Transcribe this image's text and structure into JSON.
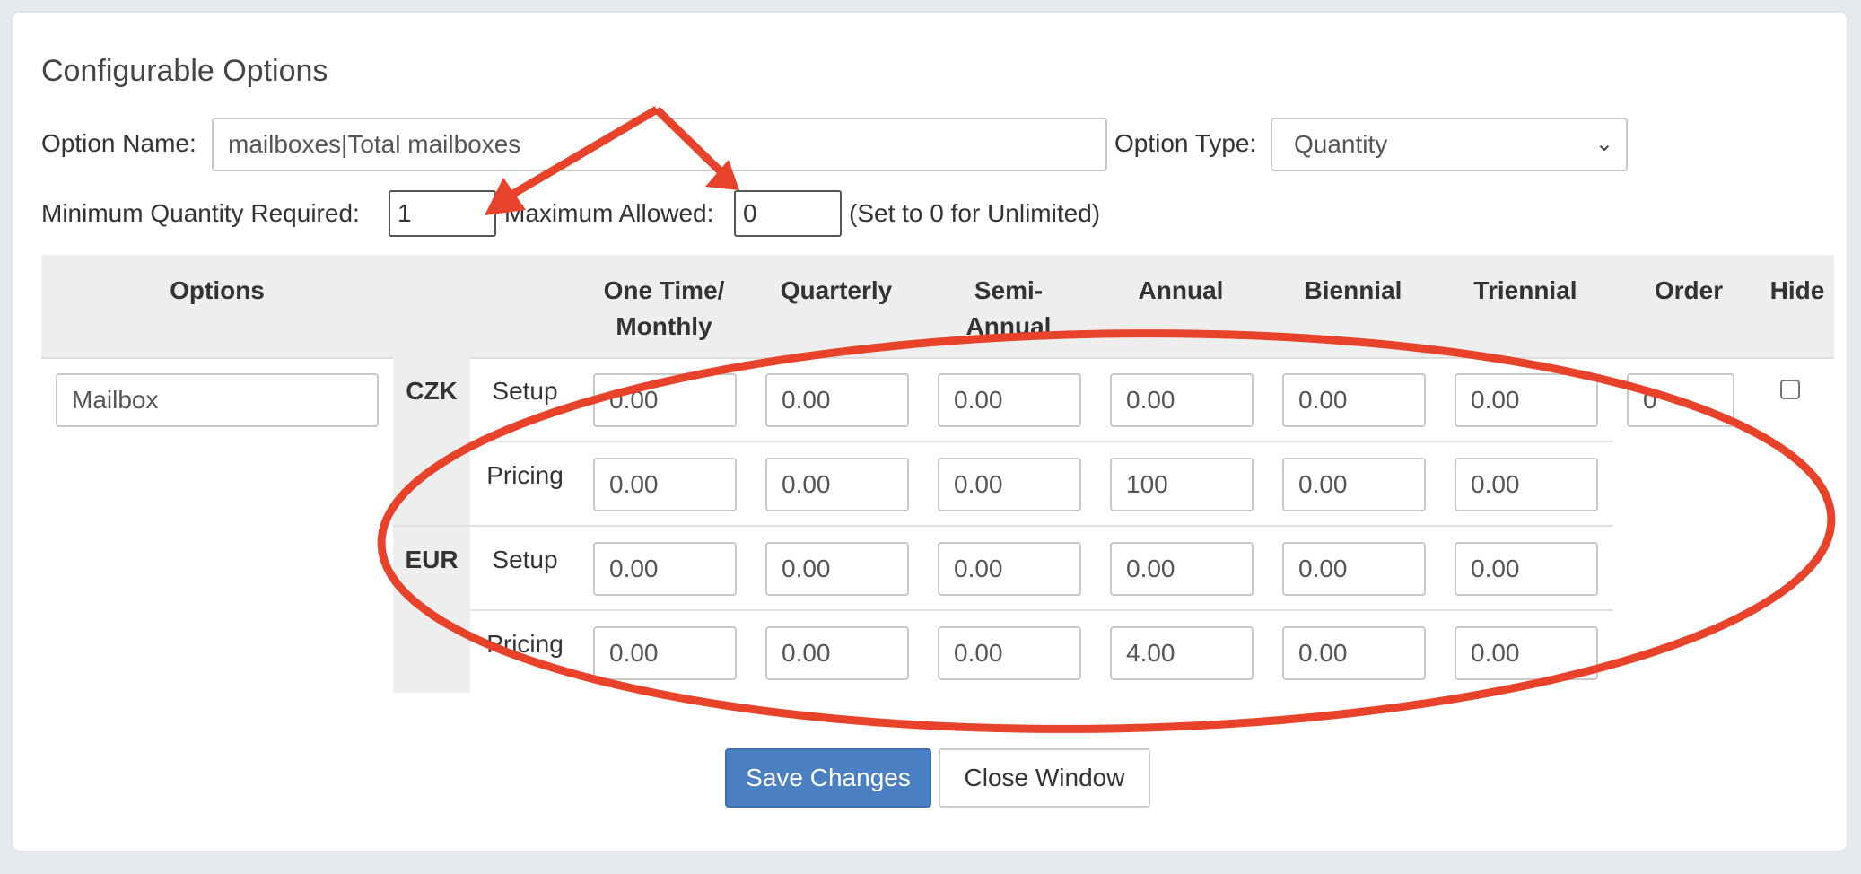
{
  "title": "Configurable Options",
  "option_name": {
    "label": "Option Name:",
    "value": "mailboxes|Total mailboxes"
  },
  "option_type": {
    "label": "Option Type:",
    "value": "Quantity"
  },
  "min_qty": {
    "label": "Minimum Quantity Required:",
    "value": "1"
  },
  "max_allowed": {
    "label": "Maximum Allowed:",
    "value": "0"
  },
  "unlimited_hint": "(Set to 0 for Unlimited)",
  "headers": {
    "options": "Options",
    "monthly_1": "One Time/",
    "monthly_2": "Monthly",
    "quarterly": "Quarterly",
    "semi_1": "Semi-",
    "semi_2": "Annual",
    "annual": "Annual",
    "biennial": "Biennial",
    "triennial": "Triennial",
    "order": "Order",
    "hide": "Hide"
  },
  "option_row": {
    "name": "Mailbox",
    "order": "0",
    "hidden": false
  },
  "row_labels": {
    "setup": "Setup",
    "pricing": "Pricing"
  },
  "currencies": [
    {
      "code": "CZK",
      "setup": [
        "0.00",
        "0.00",
        "0.00",
        "0.00",
        "0.00",
        "0.00"
      ],
      "pricing": [
        "0.00",
        "0.00",
        "0.00",
        "100",
        "0.00",
        "0.00"
      ]
    },
    {
      "code": "EUR",
      "setup": [
        "0.00",
        "0.00",
        "0.00",
        "0.00",
        "0.00",
        "0.00"
      ],
      "pricing": [
        "0.00",
        "0.00",
        "0.00",
        "4.00",
        "0.00",
        "0.00"
      ]
    }
  ],
  "buttons": {
    "save": "Save Changes",
    "close": "Close Window"
  },
  "annotation_color": "#e8432a"
}
